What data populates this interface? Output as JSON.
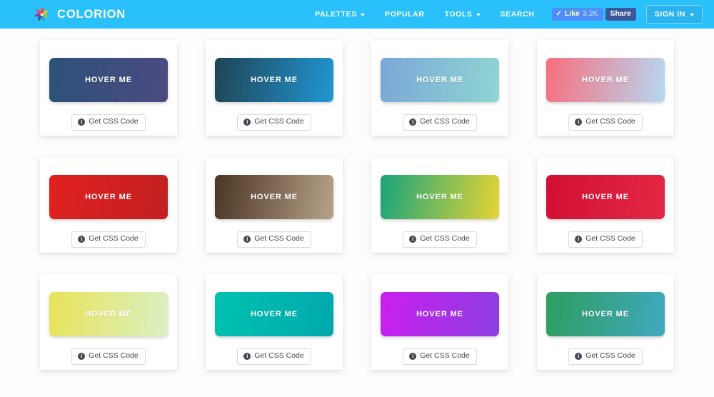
{
  "header": {
    "brand_name": "COLORION",
    "logo_icon": "pinwheel-flower-logo",
    "background_color": "#29c0fc",
    "nav_items": [
      {
        "label": "PALETTES",
        "has_caret": true
      },
      {
        "label": "POPULAR",
        "has_caret": false
      },
      {
        "label": "TOOLS",
        "has_caret": true
      },
      {
        "label": "SEARCH",
        "has_caret": false
      }
    ],
    "facebook": {
      "like_label": "Like",
      "like_count": "3.2K",
      "tick_icon": "check-icon",
      "share_label": "Share",
      "like_color": "#4f8df9",
      "share_color": "#3b5998"
    },
    "signin": {
      "label": "SIGN IN",
      "has_caret": true
    }
  },
  "main": {
    "swatch_label": "HOVER ME",
    "css_button_label": "Get CSS Code",
    "css_button_icon": "info-icon",
    "cards": [
      {
        "id": 1,
        "from": "#2c5277",
        "to": "#4c4a83"
      },
      {
        "id": 2,
        "from": "#1f4454",
        "to": "#2196d4"
      },
      {
        "id": 3,
        "from": "#7ba7d7",
        "to": "#8fd6d2"
      },
      {
        "id": 4,
        "from": "#f86e7e",
        "to": "#b6d8f2"
      },
      {
        "id": 5,
        "from": "#e02020",
        "to": "#c32020"
      },
      {
        "id": 6,
        "from": "#4a3424",
        "to": "#b7a289"
      },
      {
        "id": 7,
        "from": "#18a47b",
        "to": "#e6d434"
      },
      {
        "id": 8,
        "from": "#d10f34",
        "to": "#e52745"
      },
      {
        "id": 9,
        "from": "#e9e358",
        "to": "#d9f0c4"
      },
      {
        "id": 10,
        "from": "#00c2b0",
        "to": "#00a8ad"
      },
      {
        "id": 11,
        "from": "#cb1ef0",
        "to": "#8b3fe0"
      },
      {
        "id": 12,
        "from": "#2e9d5e",
        "to": "#41a8c0"
      }
    ]
  },
  "page": {
    "background_color": "#fdfdfd"
  }
}
